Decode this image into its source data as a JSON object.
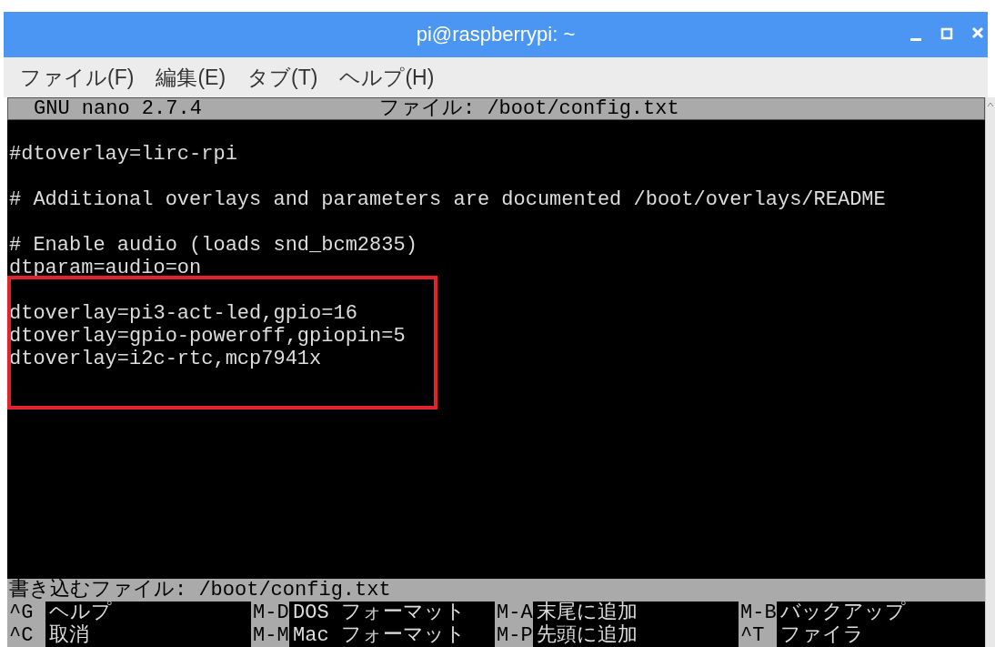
{
  "window": {
    "title": "pi@raspberrypi: ~"
  },
  "menu": [
    {
      "label": "ファイル(F)"
    },
    {
      "label": "編集(E)"
    },
    {
      "label": "タブ(T)"
    },
    {
      "label": "ヘルプ(H)"
    }
  ],
  "nano": {
    "version": "GNU nano 2.7.4",
    "file": "ファイル: /boot/config.txt"
  },
  "lines": [
    {
      "kind": "blank"
    },
    {
      "kind": "text",
      "text": "#dtoverlay=lirc-rpi",
      "highlighted": false
    },
    {
      "kind": "blank"
    },
    {
      "kind": "text",
      "text": "# Additional overlays and parameters are documented /boot/overlays/README",
      "highlighted": false
    },
    {
      "kind": "blank"
    },
    {
      "kind": "text",
      "text": "# Enable audio (loads snd_bcm2835)",
      "highlighted": false
    },
    {
      "kind": "text",
      "text": "dtparam=audio=on",
      "highlighted": false
    },
    {
      "kind": "blank"
    },
    {
      "kind": "text",
      "text": "dtoverlay=pi3-act-led,gpio=16",
      "highlighted": true
    },
    {
      "kind": "text",
      "text": "dtoverlay=gpio-poweroff,gpiopin=5",
      "highlighted": true
    },
    {
      "kind": "text",
      "text": "dtoverlay=i2c-rtc,mcp7941x",
      "highlighted": true
    }
  ],
  "prompt": "書き込むファイル: /boot/config.txt",
  "shortcuts": [
    {
      "key": "^G",
      "label": "ヘルプ"
    },
    {
      "key": "M-D",
      "label": "DOS フォーマット"
    },
    {
      "key": "M-A",
      "label": "末尾に追加"
    },
    {
      "key": "M-B",
      "label": "バックアップ"
    },
    {
      "key": "^C",
      "label": "取消"
    },
    {
      "key": "M-M",
      "label": "Mac フォーマット"
    },
    {
      "key": "M-P",
      "label": "先頭に追加"
    },
    {
      "key": "^T",
      "label": "ファイラ"
    }
  ]
}
